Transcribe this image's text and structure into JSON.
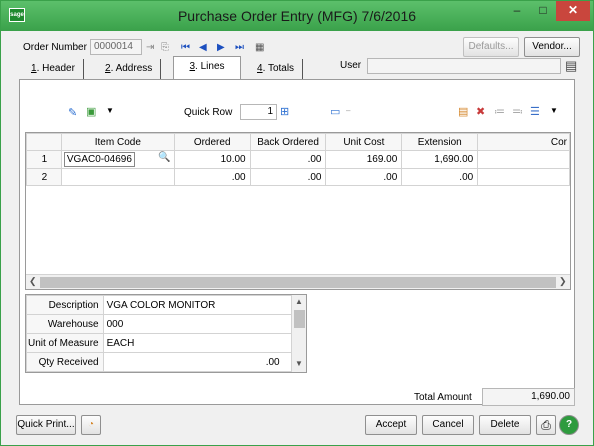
{
  "window": {
    "app_icon": "sage",
    "title": "Purchase Order Entry (MFG) 7/6/2016",
    "minimize": "–",
    "maximize": "□",
    "close": "✕"
  },
  "header": {
    "order_number_label": "Order Number",
    "order_number_value": "0000014",
    "defaults_button": "Defaults...",
    "vendor_button": "Vendor...",
    "user_label": "User",
    "user_value": ""
  },
  "tabs": [
    {
      "key": "1",
      "label": ". Header"
    },
    {
      "key": "2",
      "label": ". Address"
    },
    {
      "key": "3",
      "label": ". Lines"
    },
    {
      "key": "4",
      "label": ". Totals"
    }
  ],
  "toolbar": {
    "quick_row_label": "Quick Row",
    "quick_row_value": "1"
  },
  "grid": {
    "columns": [
      "",
      "Item Code",
      "Ordered",
      "Back Ordered",
      "Unit Cost",
      "Extension",
      "Cor"
    ],
    "rows": [
      {
        "num": "1",
        "item_code": "VGAC0-04696",
        "ordered": "10.00",
        "back_ordered": ".00",
        "unit_cost": "169.00",
        "extension": "1,690.00"
      },
      {
        "num": "2",
        "item_code": "",
        "ordered": ".00",
        "back_ordered": ".00",
        "unit_cost": ".00",
        "extension": ".00"
      }
    ]
  },
  "details": {
    "description_label": "Description",
    "description_value": "VGA COLOR MONITOR",
    "warehouse_label": "Warehouse",
    "warehouse_value": "000",
    "uom_label": "Unit of Measure",
    "uom_value": "EACH",
    "qty_received_label": "Qty Received",
    "qty_received_value": ".00"
  },
  "totals": {
    "total_amount_label": "Total Amount",
    "total_amount_value": "1,690.00"
  },
  "footer": {
    "quick_print": "Quick Print...",
    "accept": "Accept",
    "cancel": "Cancel",
    "delete": "Delete"
  }
}
